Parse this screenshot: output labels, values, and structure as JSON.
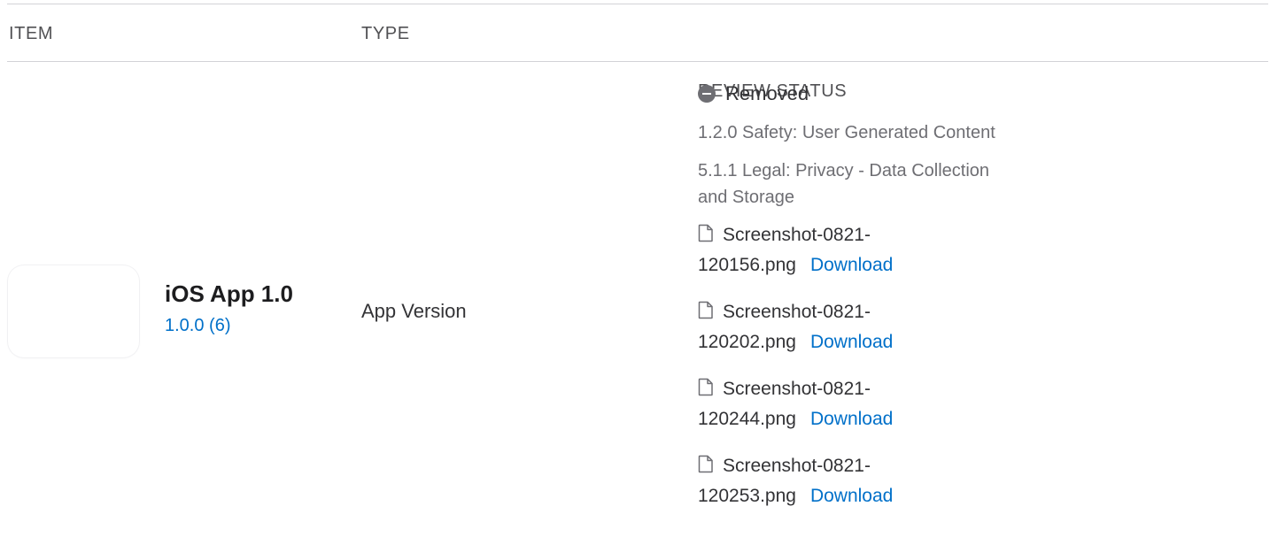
{
  "columns": {
    "item": "ITEM",
    "type": "TYPE",
    "review_status": "REVIEW STATUS"
  },
  "row": {
    "app_name": "iOS App 1.0",
    "build": "1.0.0 (6)",
    "type": "App Version",
    "status": {
      "icon": "removed-icon",
      "label": "Removed",
      "reasons": [
        "1.2.0 Safety: User Generated Content",
        "5.1.1 Legal: Privacy - Data Collection and Storage"
      ],
      "attachments": [
        {
          "name_line1": "Screenshot-0821-",
          "name_line2": "120156.png",
          "action": "Download"
        },
        {
          "name_line1": "Screenshot-0821-",
          "name_line2": "120202.png",
          "action": "Download"
        },
        {
          "name_line1": "Screenshot-0821-",
          "name_line2": "120244.png",
          "action": "Download"
        },
        {
          "name_line1": "Screenshot-0821-",
          "name_line2": "120253.png",
          "action": "Download"
        }
      ]
    }
  },
  "colors": {
    "link": "#0070c9",
    "removed_icon": "#6e6e73",
    "divider": "#d2d2d7"
  }
}
